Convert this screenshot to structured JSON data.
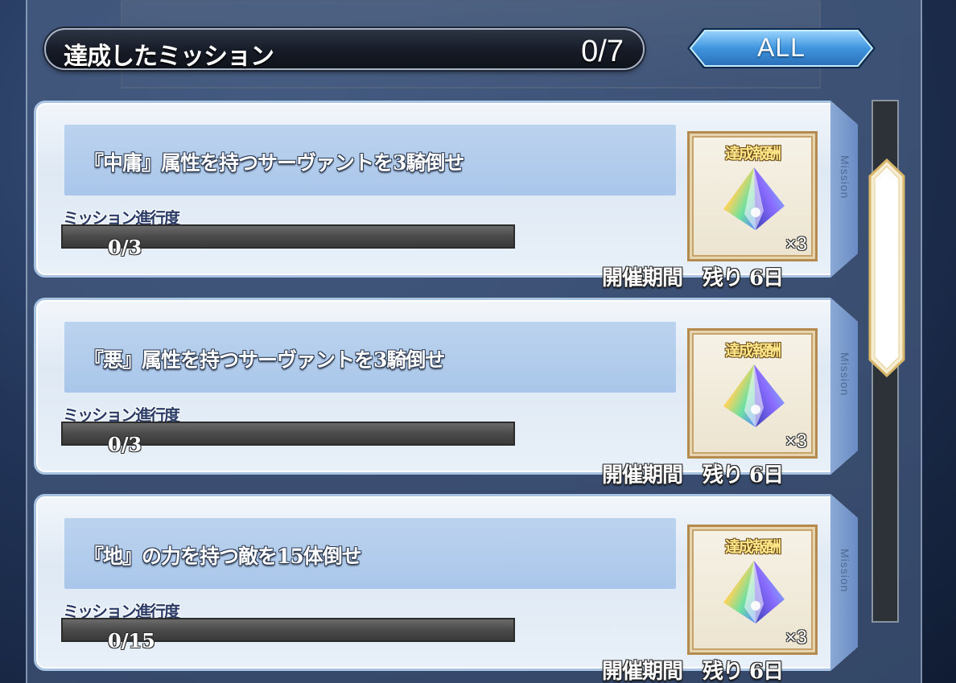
{
  "header": {
    "title": "達成したミッション",
    "count": "0/7",
    "filter_label": "ALL"
  },
  "missions": [
    {
      "title": "『中庸』属性を持つサーヴァントを3騎倒せ",
      "progress_label": "ミッション進行度",
      "progress_text": "0/3",
      "progress_fraction": 0,
      "reward_label": "達成報酬",
      "reward_icon": "saint-quartz-icon",
      "reward_qty": "×3",
      "period": "開催期間　残り 6日",
      "side_label": "Mission"
    },
    {
      "title": "『悪』属性を持つサーヴァントを3騎倒せ",
      "progress_label": "ミッション進行度",
      "progress_text": "0/3",
      "progress_fraction": 0,
      "reward_label": "達成報酬",
      "reward_icon": "saint-quartz-icon",
      "reward_qty": "×3",
      "period": "開催期間　残り 6日",
      "side_label": "Mission"
    },
    {
      "title": "『地』の力を持つ敵を15体倒せ",
      "progress_label": "ミッション進行度",
      "progress_text": "0/15",
      "progress_fraction": 0,
      "reward_label": "達成報酬",
      "reward_icon": "saint-quartz-icon",
      "reward_qty": "×3",
      "period": "開催期間　残り 6日",
      "side_label": "Mission"
    }
  ],
  "scroll": {
    "position_fraction": 0.0
  },
  "colors": {
    "card_border": "#a9c4e3",
    "reward_frame": "#b48a4e",
    "filter_button": "#4fa6e8"
  }
}
